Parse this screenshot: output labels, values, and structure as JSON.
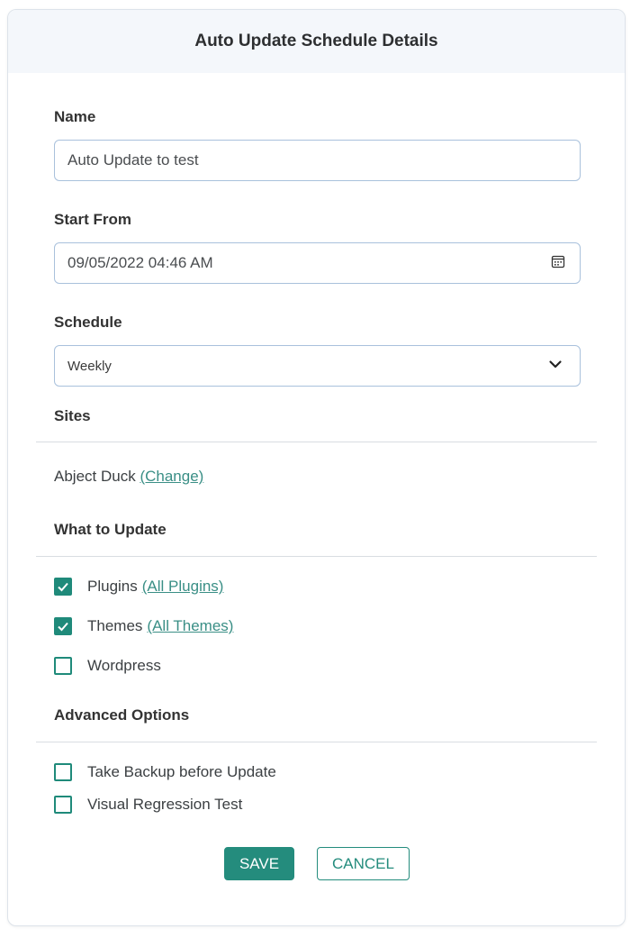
{
  "dialog": {
    "title": "Auto Update Schedule Details"
  },
  "form": {
    "name": {
      "label": "Name",
      "value": "Auto Update to test"
    },
    "start_from": {
      "label": "Start From",
      "value": "09/05/2022 04:46 AM"
    },
    "schedule": {
      "label": "Schedule",
      "value": "Weekly"
    }
  },
  "sites": {
    "heading": "Sites",
    "site_name": "Abject Duck",
    "change_link": "(Change)"
  },
  "what_to_update": {
    "heading": "What to Update",
    "items": [
      {
        "label": "Plugins",
        "link": "(All Plugins)",
        "checked": true
      },
      {
        "label": "Themes",
        "link": "(All Themes)",
        "checked": true
      },
      {
        "label": "Wordpress",
        "checked": false
      }
    ]
  },
  "advanced_options": {
    "heading": "Advanced Options",
    "items": [
      {
        "label": "Take Backup before Update",
        "checked": false
      },
      {
        "label": "Visual Regression Test",
        "checked": false
      }
    ]
  },
  "buttons": {
    "save": "SAVE",
    "cancel": "CANCEL"
  },
  "colors": {
    "accent": "#248c7d",
    "header_bg": "#f4f7fb",
    "field_border": "#a9c1dc"
  }
}
